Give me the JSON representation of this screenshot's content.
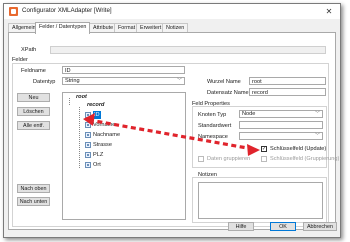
{
  "window": {
    "title": "Configurator XMLAdapter [Write]",
    "close_glyph": "✕"
  },
  "tabs": [
    "Allgemein",
    "Felder / Datentypen",
    "Attribute",
    "Format",
    "Erweitert",
    "Notizen"
  ],
  "xpath": {
    "label": "XPath",
    "value": ""
  },
  "felder": {
    "title": "Felder",
    "feldname_label": "Feldname",
    "feldname_value": "ID",
    "datentyp_label": "Datentyp",
    "datentyp_value": "String",
    "buttons": {
      "neu": "Neu",
      "loeschen": "Löschen",
      "alle_entf": "Alle entf.",
      "nach_oben": "Nach oben",
      "nach_unten": "Nach unten"
    }
  },
  "tree": {
    "root": "root",
    "record": "record",
    "fields": [
      "ID",
      "Vorname",
      "Nachname",
      "Strasse",
      "PLZ",
      "Ort"
    ],
    "selected": "ID"
  },
  "right": {
    "wurzel_label": "Wurzel Name",
    "wurzel_value": "root",
    "datensatz_label": "Datensatz Name",
    "datensatz_value": "record",
    "props_title": "Feld Properties",
    "knoten_label": "Knoten Typ",
    "knoten_value": "Node",
    "standardwert_label": "Standardwert",
    "standardwert_value": "",
    "third_label": "Namespace",
    "third_value": "",
    "schluessel_update": "Schlüsselfeld (Update)",
    "schluessel_update_checked": true,
    "check_mark": "✓",
    "daten_gruppieren": "Daten gruppieren",
    "schluessel_gruppierung": "Schlüsselfeld (Gruppierung)",
    "notizen_title": "Notizen"
  },
  "footer": {
    "hilfe": "Hilfe",
    "ok": "OK",
    "abbrechen": "Abbrechen"
  },
  "colors": {
    "accent": "#0078d7",
    "arrow": "#e0242c",
    "titlebar_icon": "#e8692f",
    "selection": "#0078d7"
  },
  "icons": {
    "app": "app-icon",
    "field": "field-node-icon",
    "close": "close-icon"
  }
}
